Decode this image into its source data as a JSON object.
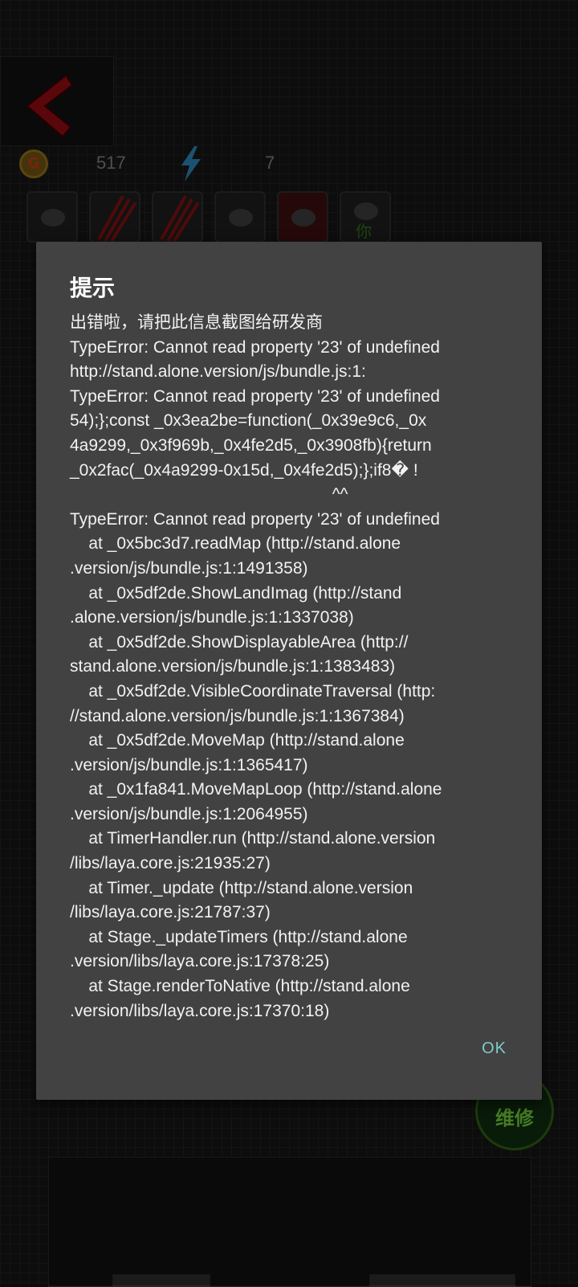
{
  "hud": {
    "coin_icon_letter": "G",
    "coins": "517",
    "energy": "7"
  },
  "characters": [
    {
      "name": "character-slot-1"
    },
    {
      "name": "character-slot-2"
    },
    {
      "name": "character-slot-3"
    },
    {
      "name": "character-slot-4"
    },
    {
      "name": "character-slot-5"
    },
    {
      "name": "character-slot-6",
      "label": "你"
    }
  ],
  "repair_button": {
    "label": "维修"
  },
  "dialog": {
    "title": "提示",
    "message": "出错啦，请把此信息截图给研发商\nTypeError: Cannot read property '23' of undefined\nhttp://stand.alone.version/js/bundle.js:1:\nTypeError: Cannot read property '23' of undefined\n54);};const _0x3ea2be=function(_0x39e9c6,_0x\n4a9299,_0x3f969b,_0x4fe2d5,_0x3908fb){return\n_0x2fac(_0x4a9299-0x15d,_0x4fe2d5);};if8� !\n                                                        ^^\nTypeError: Cannot read property '23' of undefined\n    at _0x5bc3d7.readMap (http://stand.alone\n.version/js/bundle.js:1:1491358)\n    at _0x5df2de.ShowLandImag (http://stand\n.alone.version/js/bundle.js:1:1337038)\n    at _0x5df2de.ShowDisplayableArea (http://\nstand.alone.version/js/bundle.js:1:1383483)\n    at _0x5df2de.VisibleCoordinateTraversal (http:\n//stand.alone.version/js/bundle.js:1:1367384)\n    at _0x5df2de.MoveMap (http://stand.alone\n.version/js/bundle.js:1:1365417)\n    at _0x1fa841.MoveMapLoop (http://stand.alone\n.version/js/bundle.js:1:2064955)\n    at TimerHandler.run (http://stand.alone.version\n/libs/laya.core.js:21935:27)\n    at Timer._update (http://stand.alone.version\n/libs/laya.core.js:21787:37)\n    at Stage._updateTimers (http://stand.alone\n.version/libs/laya.core.js:17378:25)\n    at Stage.renderToNative (http://stand.alone\n.version/libs/laya.core.js:17370:18)",
    "ok_label": "OK"
  },
  "colors": {
    "dialog_bg": "#424242",
    "accent": "#80cbc4",
    "back_arrow": "#c0101a"
  }
}
